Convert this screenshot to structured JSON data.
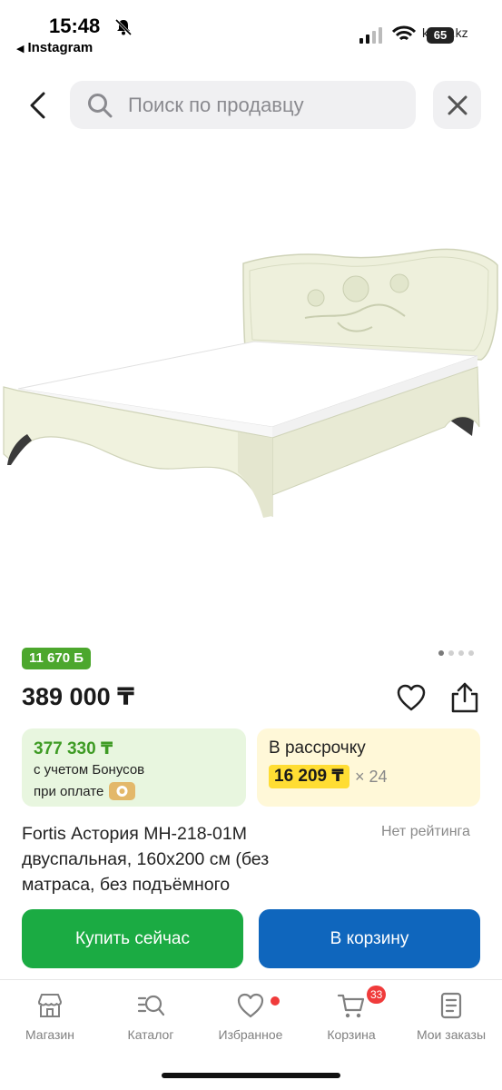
{
  "status_bar": {
    "time": "15:48",
    "back_app": "Instagram",
    "url": "kaspi.kz",
    "battery": "65"
  },
  "search": {
    "placeholder": "Поиск по продавцу"
  },
  "product": {
    "bonus_badge": "11 670 Б",
    "price": "389 000 ₸",
    "gallery_pages": 4,
    "gallery_active": 1,
    "bonus_card": {
      "price": "377 330 ₸",
      "line1": "с учетом Бонусов",
      "line2": "при оплате"
    },
    "installment_card": {
      "title": "В рассрочку",
      "amount": "16 209 ₸",
      "term": "× 24"
    },
    "title": "Fortis Астория МН-218-01М двуспальная, 160х200 см (без матраса, без подъёмного",
    "rating": "Нет рейтинга"
  },
  "actions": {
    "buy_now": "Купить сейчас",
    "add_to_cart": "В корзину"
  },
  "bottom_nav": {
    "items": [
      {
        "label": "Магазин",
        "icon": "store-icon"
      },
      {
        "label": "Каталог",
        "icon": "catalog-search-icon"
      },
      {
        "label": "Избранное",
        "icon": "heart-icon"
      },
      {
        "label": "Корзина",
        "icon": "cart-icon",
        "badge": "33"
      },
      {
        "label": "Мои заказы",
        "icon": "orders-icon"
      }
    ]
  },
  "colors": {
    "bonus_green": "#4ca72d",
    "buy_green": "#1bab43",
    "cart_blue": "#0f66bd",
    "installment_yellow": "#ffdd33",
    "badge_red": "#f03b3b"
  }
}
